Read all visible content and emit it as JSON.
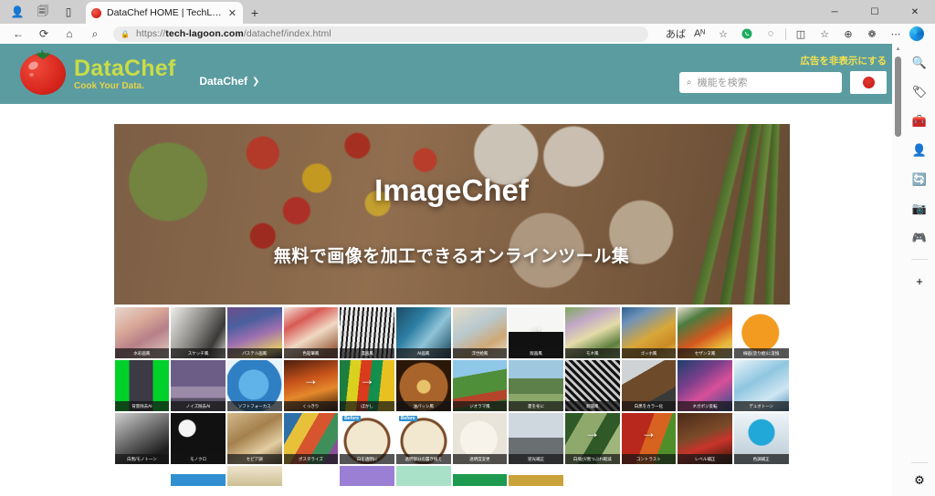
{
  "browser": {
    "tab": {
      "title": "DataChef HOME | TechLagoon",
      "close": "✕"
    },
    "newtab": "+",
    "window_controls": {
      "minimize": "─",
      "maximize": "☐",
      "close": "✕"
    },
    "toolbar_left": {
      "back": "←",
      "refresh": "⟳",
      "home": "⌂",
      "search": "⌕"
    },
    "url": {
      "prefix": "https://",
      "domain": "tech-lagoon.com",
      "path": "/datachef/index.html",
      "lock": "ὑ2"
    },
    "toolbar_right": {
      "read_aloud": "あば",
      "immersive_reader": "Aᴺ",
      "favorite": "☆",
      "split_screen": "◫",
      "collections": "☆",
      "browser_essentials": "⊕",
      "extensions": "❁",
      "more": "⋯"
    },
    "sidebar_icons": [
      "search-icon",
      "shopping-icon",
      "tools-icon",
      "contacts-icon",
      "office-icon",
      "outlook-icon",
      "games-icon",
      "add-icon",
      "settings-icon"
    ]
  },
  "site": {
    "brand": {
      "name": "DataChef",
      "tagline": "Cook Your Data."
    },
    "breadcrumb": {
      "label": "DataChef",
      "chevron": "❯"
    },
    "hide_ads_label": "広告を非表示にする",
    "search": {
      "placeholder": "機能を検索",
      "value": "",
      "icon": "⌕"
    },
    "language_button": "japan-flag",
    "colors": {
      "header": "#5b9ca1",
      "brand": "#c8dd47",
      "tagline": "#e7d24a",
      "hide_ads": "#f5e24e"
    }
  },
  "hero": {
    "title": "ImageChef",
    "subtitle": "無料で画像を加工できるオンラインツール集"
  },
  "grid": {
    "rows": [
      {
        "cells": [
          {
            "label": "水彩画風",
            "style": "watercolor"
          },
          {
            "label": "スケッチ風",
            "style": "sketch"
          },
          {
            "label": "パステル画風",
            "style": "pastel"
          },
          {
            "label": "色鉛筆風",
            "style": "pencil"
          },
          {
            "label": "漫画風",
            "style": "manga"
          },
          {
            "label": "AI画風",
            "style": "ai"
          },
          {
            "label": "浮世絵風",
            "style": "ukiyoe"
          },
          {
            "label": "版画風",
            "style": "hanga",
            "arrow": true
          },
          {
            "label": "モネ風",
            "style": "monet"
          },
          {
            "label": "ゴッホ風",
            "style": "gogh"
          },
          {
            "label": "セザンヌ風",
            "style": "cezanne"
          },
          {
            "label": "線画(塗り絵)に変換",
            "style": "lineart"
          }
        ]
      },
      {
        "cells": [
          {
            "label": "背景除去AI",
            "style": "greenscreen"
          },
          {
            "label": "ノイズ除去AI",
            "style": "denoise"
          },
          {
            "label": "ソフトフォーカス",
            "style": "softfocus"
          },
          {
            "label": "くっきり",
            "style": "sharpen",
            "arrow": true
          },
          {
            "label": "ぼかし",
            "style": "blur",
            "arrow": true
          },
          {
            "label": "油パッシ風",
            "style": "pancake"
          },
          {
            "label": "ジオラマ風",
            "style": "diorama"
          },
          {
            "label": "夏を冬に",
            "style": "summerwinter"
          },
          {
            "label": "新聞風",
            "style": "newspaper"
          },
          {
            "label": "白黒をカラー化",
            "style": "colorize"
          },
          {
            "label": "ネガポジ反転",
            "style": "negative"
          },
          {
            "label": "デュオトーン",
            "style": "duotone"
          }
        ]
      },
      {
        "cells": [
          {
            "label": "白黒/モノトーン",
            "style": "monotone"
          },
          {
            "label": "モノクロ",
            "style": "bw"
          },
          {
            "label": "セピア調",
            "style": "sepia"
          },
          {
            "label": "ポスタライズ",
            "style": "posterize"
          },
          {
            "label": "白を透明に",
            "style": "ramenA",
            "badge": "Before"
          },
          {
            "label": "透明部分の置き換え",
            "style": "ramenB",
            "badge": "Before"
          },
          {
            "label": "透明度変更",
            "style": "ghost"
          },
          {
            "label": "逆光補正",
            "style": "backlight"
          },
          {
            "label": "白飛び/黒つぶれ軽減",
            "style": "hdr",
            "arrow": true
          },
          {
            "label": "コントラスト",
            "style": "contrast",
            "arrow": true
          },
          {
            "label": "レベル補正",
            "style": "levels"
          },
          {
            "label": "色調補正",
            "style": "colorbalance"
          }
        ]
      },
      {
        "cells": [
          {
            "label": "",
            "style": "r4a"
          },
          {
            "label": "",
            "style": "r4b"
          },
          {
            "label": "",
            "style": "r4c"
          },
          {
            "label": "",
            "style": "r4d"
          },
          {
            "label": "",
            "style": "r4e"
          },
          {
            "label": "",
            "style": "r4f"
          },
          {
            "label": "",
            "style": "r4g"
          },
          {
            "label": "",
            "style": "r4h"
          },
          {
            "label": "",
            "style": "r4i"
          },
          {
            "label": "",
            "style": "r4j"
          },
          {
            "label": "",
            "style": "r4k"
          },
          {
            "label": "",
            "style": "r4l"
          }
        ]
      }
    ]
  }
}
